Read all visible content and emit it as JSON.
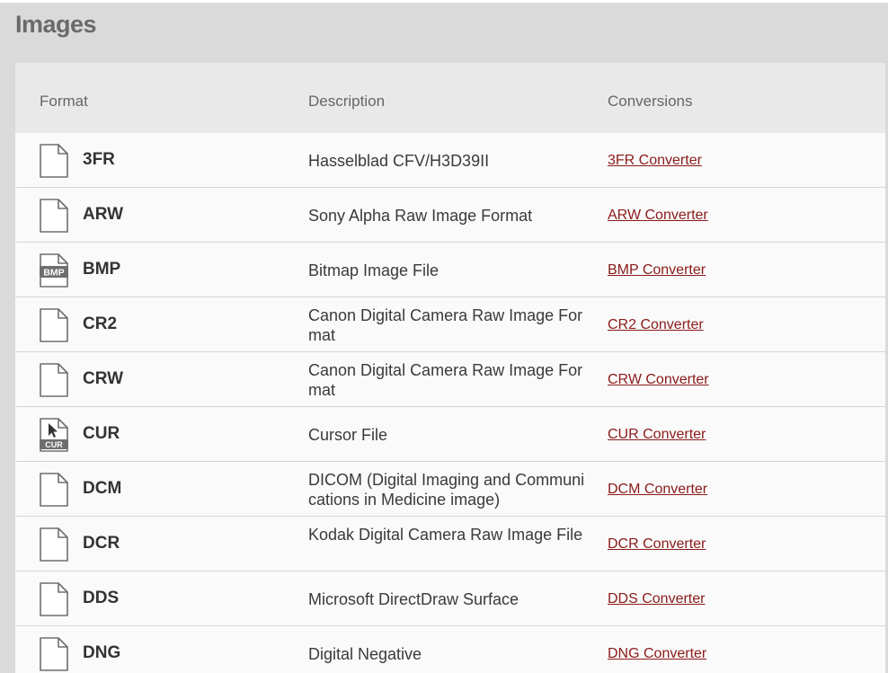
{
  "section": {
    "title": "Images"
  },
  "table": {
    "headers": {
      "format": "Format",
      "description": "Description",
      "conversions": "Conversions"
    },
    "rows": [
      {
        "icon": "file-icon",
        "format": "3FR",
        "description": "Hasselblad CFV/H3D39II",
        "converter": "3FR Converter"
      },
      {
        "icon": "file-icon",
        "format": "ARW",
        "description": "Sony Alpha Raw Image Format",
        "converter": "ARW Converter"
      },
      {
        "icon": "bmp-file-icon",
        "icon_text": "BMP",
        "format": "BMP",
        "description": "Bitmap Image File",
        "converter": "BMP Converter"
      },
      {
        "icon": "file-icon",
        "format": "CR2",
        "description": "Canon Digital Camera Raw Image Format",
        "converter": "CR2 Converter"
      },
      {
        "icon": "file-icon",
        "format": "CRW",
        "description": "Canon Digital Camera Raw Image Format",
        "converter": "CRW Converter"
      },
      {
        "icon": "cur-file-icon",
        "icon_text": "CUR",
        "format": "CUR",
        "description": "Cursor File",
        "converter": "CUR Converter"
      },
      {
        "icon": "file-icon",
        "format": "DCM",
        "description": "DICOM (Digital Imaging and Communications in Medicine image)",
        "converter": "DCM Converter"
      },
      {
        "icon": "file-icon",
        "format": "DCR",
        "description": "Kodak Digital Camera Raw Image File",
        "converter": "DCR Converter"
      },
      {
        "icon": "file-icon",
        "format": "DDS",
        "description": "Microsoft DirectDraw Surface",
        "converter": "DDS Converter"
      },
      {
        "icon": "file-icon",
        "format": "DNG",
        "description": "Digital Negative",
        "converter": "DNG Converter"
      }
    ]
  },
  "colors": {
    "background": "#dadada",
    "header_bg": "#e9e9e9",
    "row_bg": "#fafafa",
    "link": "#8b1a1a",
    "title": "#6a6a6a"
  }
}
